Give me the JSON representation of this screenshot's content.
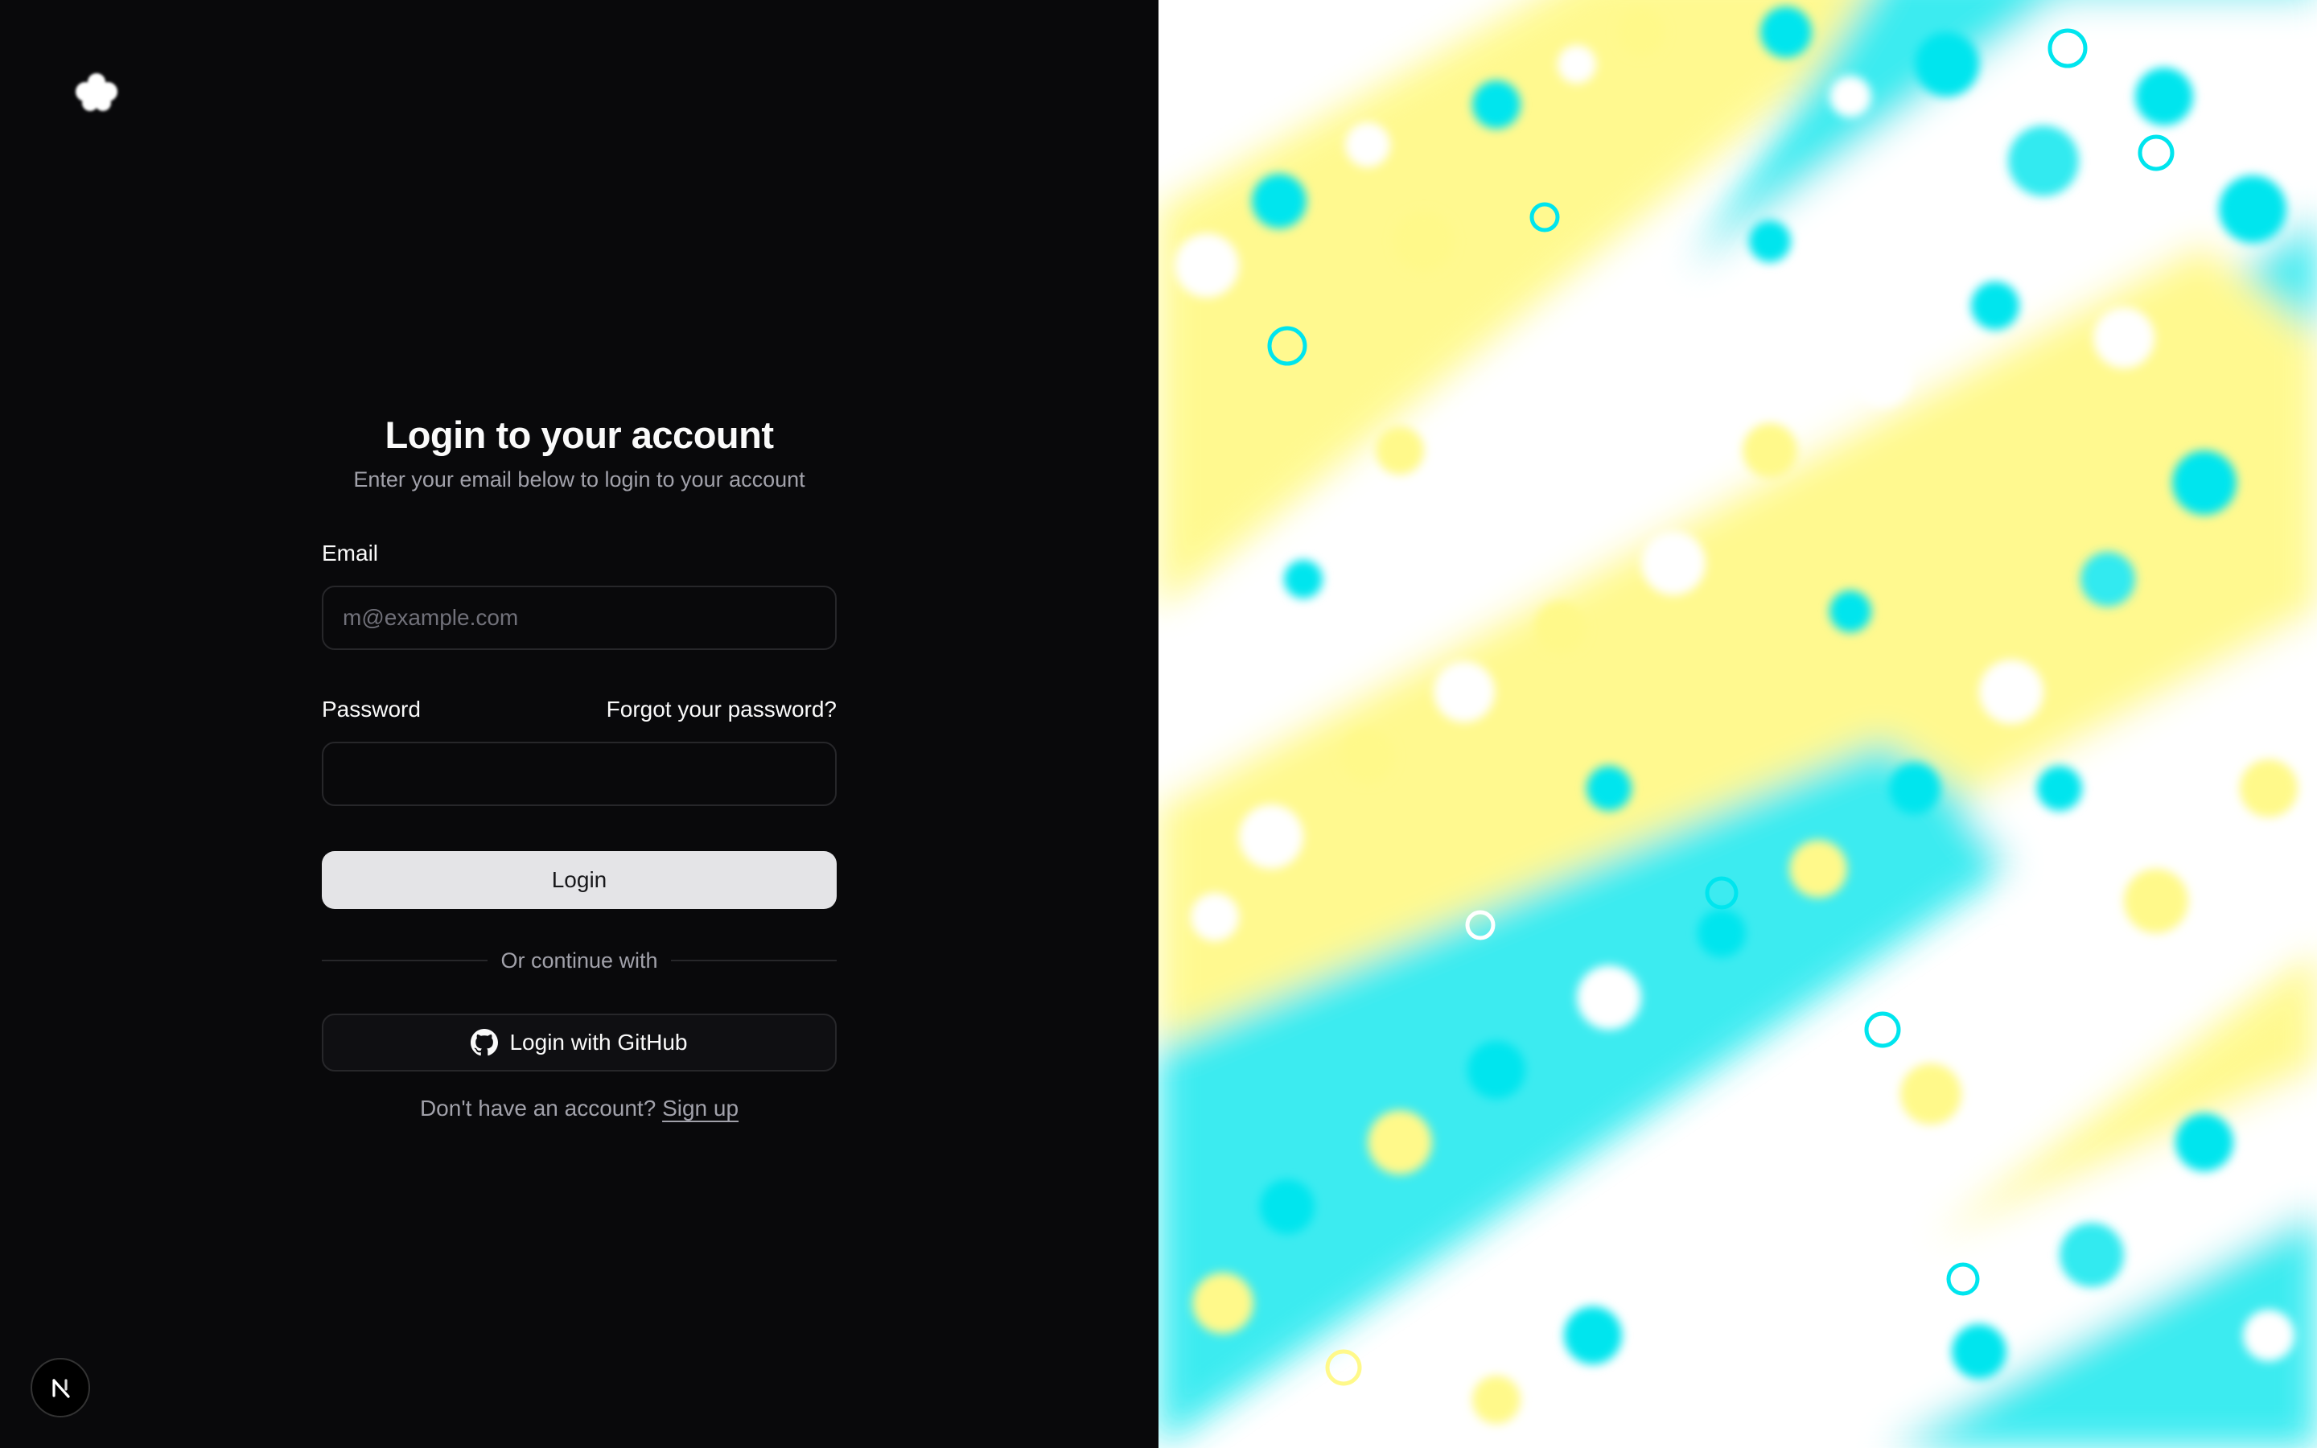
{
  "brand": {
    "logo_icon": "cloud-logo-icon"
  },
  "login_form": {
    "title": "Login to your account",
    "subtitle": "Enter your email below to login to your account",
    "email_label": "Email",
    "email_value": "",
    "email_placeholder": "m@example.com",
    "password_label": "Password",
    "password_value": "",
    "forgot_link": "Forgot your password?",
    "login_button": "Login",
    "divider_text": "Or continue with",
    "github_button": "Login with GitHub",
    "github_icon": "github-icon",
    "signup_prompt": "Don't have an account?",
    "signup_link": "Sign up"
  },
  "dev_badge": {
    "icon": "nextjs-icon"
  },
  "colors": {
    "background": "#09090b",
    "primary_button": "#e4e4e7",
    "accent_cyan": "#00e5ee",
    "accent_yellow": "#fff98a"
  }
}
